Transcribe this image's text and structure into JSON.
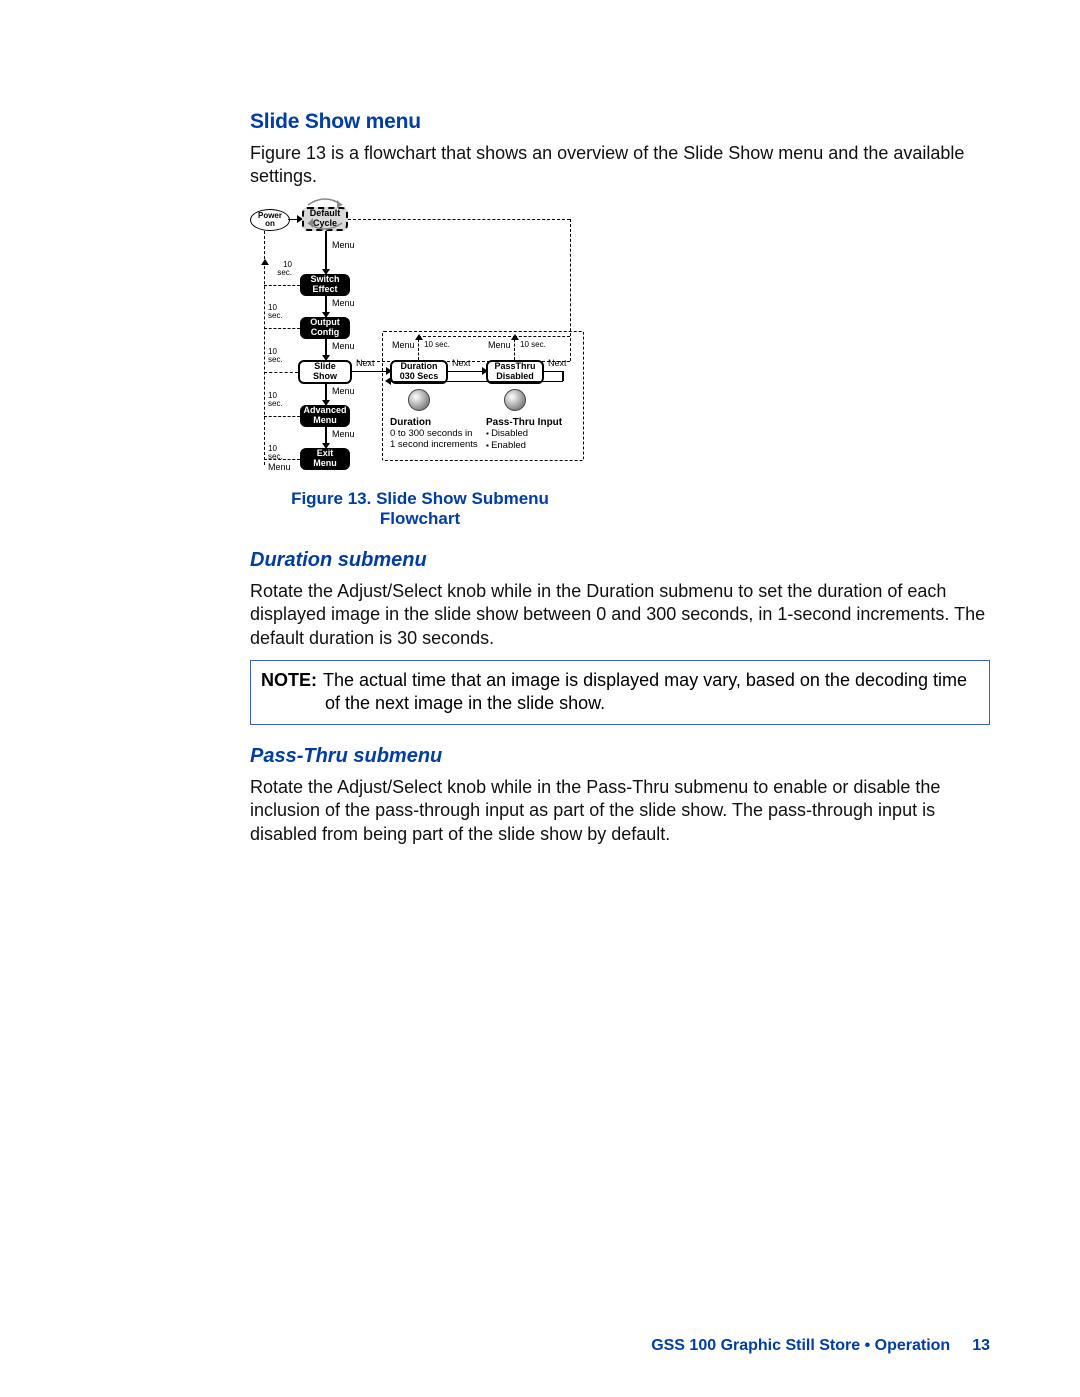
{
  "headings": {
    "slide_show_menu": "Slide Show menu",
    "duration_submenu": "Duration submenu",
    "pass_thru_submenu": "Pass-Thru submenu"
  },
  "paragraphs": {
    "intro": "Figure 13 is a flowchart that shows an overview of the Slide Show menu and the available settings.",
    "figure_caption": "Figure 13. Slide Show Submenu Flowchart",
    "duration_para": "Rotate the Adjust/Select knob while in the Duration submenu to set the duration of each displayed image in the slide show between 0 and 300 seconds, in 1-second increments. The default duration is 30 seconds.",
    "passthru_para": "Rotate the Adjust/Select knob while in the Pass-Thru submenu to enable or disable the inclusion of the pass-through input as part of the slide show. The pass-through input is disabled from being part of the slide show by default."
  },
  "note": {
    "label": "NOTE:",
    "text_line1": "The actual time that an image is displayed may vary, based on the decoding time",
    "text_line2": "of the next image in the slide show."
  },
  "footer": {
    "text": "GSS 100 Graphic Still Store • Operation",
    "page": "13"
  },
  "diagram": {
    "power_on": "Power\non",
    "default_cycle": "Default\nCycle",
    "switch_effect": "Switch\nEffect",
    "output_config": "Output\nConfig",
    "slide_show": "Slide\nShow",
    "advanced_menu": "Advanced\nMenu",
    "exit_menu": "Exit\nMenu",
    "duration_box": "Duration\n030  Secs",
    "passthru_box": "PassThru\nDisabled",
    "label_menu": "Menu",
    "label_next": "Next",
    "label_10sec": "10 sec.",
    "label_10sec_v": "10\nsec.",
    "desc_duration_title": "Duration",
    "desc_duration_text": "0 to 300 seconds in\n1 second increments",
    "desc_passthru_title": "Pass-Thru Input",
    "desc_passthru_item1": "Disabled",
    "desc_passthru_item2": "Enabled"
  }
}
